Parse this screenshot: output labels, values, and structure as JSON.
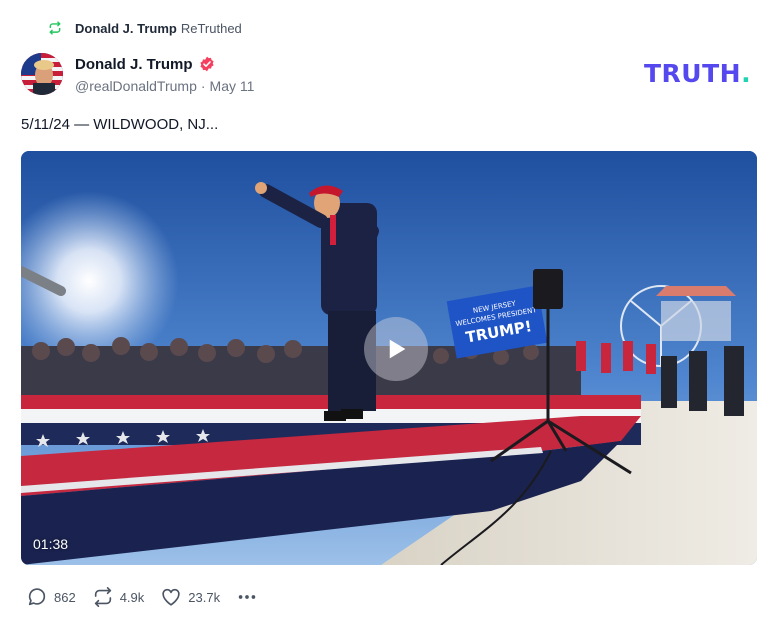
{
  "retruth": {
    "icon": "retruth-icon",
    "name": "Donald J. Trump",
    "label": "ReTruthed"
  },
  "author": {
    "name": "Donald J. Trump",
    "handle": "@realDonaldTrump",
    "separator": "·",
    "date": "May 11",
    "verified_color": "#f43f5e"
  },
  "logo": {
    "text": "TRUTH",
    "dot": ".",
    "color": "#5448ee",
    "dot_color": "#22d3b1"
  },
  "post": {
    "text": "5/11/24 — WILDWOOD, NJ..."
  },
  "video": {
    "duration": "01:38",
    "banner_line1": "NEW JERSEY",
    "banner_line2": "WELCOMES PRESIDENT",
    "banner_line3": "TRUMP!"
  },
  "actions": {
    "replies": "862",
    "retruths": "4.9k",
    "likes": "23.7k"
  }
}
